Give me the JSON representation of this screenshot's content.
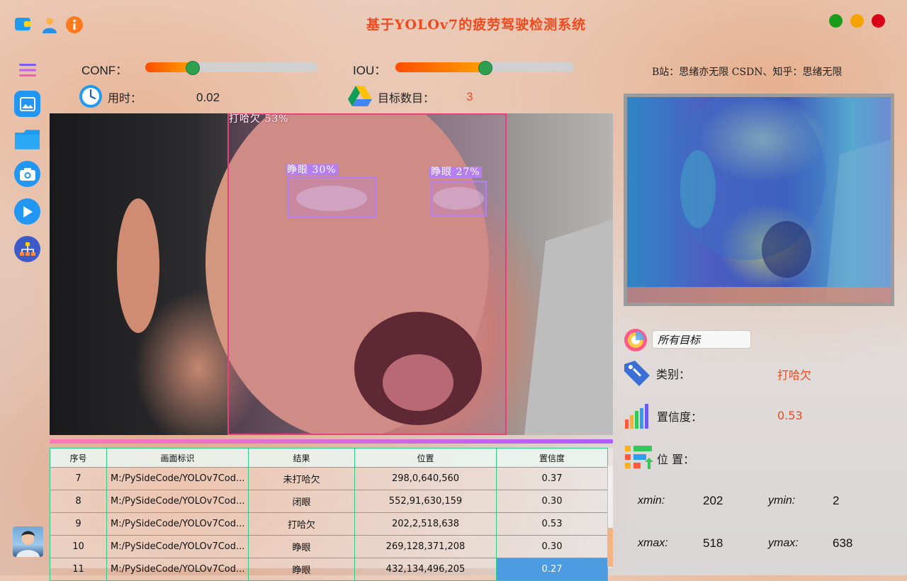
{
  "app": {
    "title": "基于YOLOv7的疲劳驾驶检测系统",
    "credit": "B站：思绪亦无限  CSDN、知乎：思绪无限"
  },
  "colors": {
    "accent": "#ef4a1f",
    "close": "#d9001b",
    "minimize": "#f5a300",
    "maximize": "#1a9c1a",
    "table_border": "#2fcf8a",
    "selected_cell": "#4d9be0"
  },
  "sliders": {
    "conf": {
      "label": "CONF：",
      "value": 0.27
    },
    "iou": {
      "label": "IOU：",
      "value": 0.5
    }
  },
  "stats": {
    "time_label": "用时：",
    "time_value": "0.02",
    "count_label": "目标数目：",
    "count_value": "3"
  },
  "detections": [
    {
      "label": "打哈欠  53%",
      "color": "#e8407a"
    },
    {
      "label": "睁眼  30%",
      "color": "#b57ff0"
    },
    {
      "label": "睁眼  27%",
      "color": "#b57ff0"
    }
  ],
  "table": {
    "headers": [
      "序号",
      "画面标识",
      "结果",
      "位置",
      "置信度"
    ],
    "rows": [
      [
        "7",
        "M:/PySideCode/YOLOv7Cod...",
        "未打哈欠",
        "298,0,640,560",
        "0.37"
      ],
      [
        "8",
        "M:/PySideCode/YOLOv7Cod...",
        "闭眼",
        "552,91,630,159",
        "0.30"
      ],
      [
        "9",
        "M:/PySideCode/YOLOv7Cod...",
        "打哈欠",
        "202,2,518,638",
        "0.53"
      ],
      [
        "10",
        "M:/PySideCode/YOLOv7Cod...",
        "睁眼",
        "269,128,371,208",
        "0.30"
      ],
      [
        "11",
        "M:/PySideCode/YOLOv7Cod...",
        "睁眼",
        "432,134,496,205",
        "0.27"
      ]
    ]
  },
  "info": {
    "target_select": "所有目标",
    "class_label": "类别：",
    "class_value": "打哈欠",
    "conf_label": "置信度：",
    "conf_value": "0.53",
    "pos_label": "位 置：",
    "xmin_label": "xmin:",
    "xmin_value": "202",
    "ymin_label": "ymin:",
    "ymin_value": "2",
    "xmax_label": "xmax:",
    "xmax_value": "518",
    "ymax_label": "ymax:",
    "ymax_value": "638"
  },
  "icons": {
    "sidebar": [
      "menu-icon",
      "image-icon",
      "folder-icon",
      "camera-icon",
      "play-icon",
      "model-icon"
    ],
    "top": [
      "logo-icon",
      "user-icon",
      "info-icon"
    ]
  }
}
